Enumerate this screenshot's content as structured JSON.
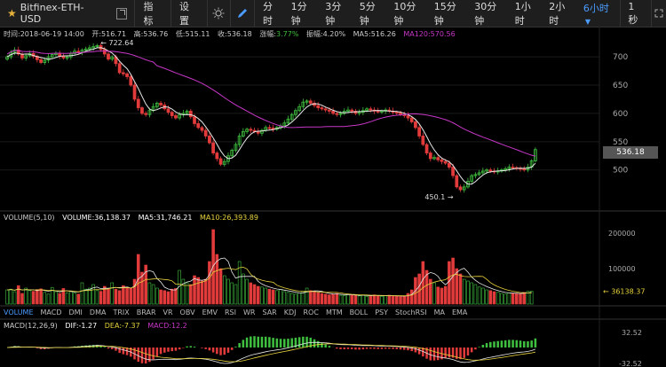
{
  "toolbar": {
    "symbol": "Bitfinex-ETH-USD",
    "indicator_btn": "指标",
    "settings_btn": "设置",
    "periods": [
      "分时",
      "1分钟",
      "3分钟",
      "5分钟",
      "10分钟",
      "15分钟",
      "30分钟",
      "1小时",
      "2小时",
      "6小时"
    ],
    "active_period": "6小时",
    "right_label": "1秒"
  },
  "info_bar": {
    "time": "时间:2018-06-19 14:00",
    "open": "开:516.71",
    "high": "高:536.76",
    "low": "低:515.11",
    "close": "收:536.18",
    "change_label": "涨幅:",
    "change_value": "3.77%",
    "amp_label": "振幅:",
    "amp_value": "4.20%",
    "ma5": "MA5:516.26",
    "ma120": "MA120:570.56"
  },
  "price_axis": [
    "700",
    "650",
    "600",
    "550",
    "500"
  ],
  "current_price": "536.18",
  "annotations": {
    "high": "← 722.64",
    "low": "450.1 →"
  },
  "volume": {
    "label": "VOLUME(5,10)",
    "value": "VOLUME:36,138.37",
    "ma5": "MA5:31,746.21",
    "ma10": "MA10:26,393.89",
    "axis": [
      "200000",
      "100000"
    ],
    "current": "← 36138.37"
  },
  "indicator_tabs": [
    "VOLUME",
    "MACD",
    "DMI",
    "DMA",
    "TRIX",
    "BRAR",
    "VR",
    "OBV",
    "EMV",
    "RSI",
    "WR",
    "SAR",
    "KDJ",
    "ROC",
    "MTM",
    "BOLL",
    "PSY",
    "StochRSI",
    "MA",
    "EMA"
  ],
  "macd": {
    "label": "MACD(12,26,9)",
    "dif": "DIF:-1.27",
    "dea": "DEA:-7.37",
    "macd": "MACD:12.2",
    "axis_top": "32.52",
    "axis_bottom": "-32.52"
  },
  "colors": {
    "up": "#3fbf3f",
    "down": "#e23b3b",
    "ma120": "#c837c8",
    "ma_white": "#e8e8e8",
    "ma_yellow": "#e6d23c",
    "accent": "#4b9cff"
  },
  "chart_data": {
    "type": "candlestick",
    "price_range": [
      440,
      730
    ],
    "closes": [
      700,
      708,
      712,
      705,
      698,
      702,
      706,
      701,
      695,
      690,
      694,
      700,
      704,
      706,
      701,
      698,
      700,
      706,
      710,
      708,
      712,
      714,
      716,
      718,
      720,
      713,
      705,
      696,
      700,
      688,
      672,
      670,
      665,
      650,
      625,
      610,
      600,
      598,
      605,
      612,
      618,
      615,
      608,
      602,
      596,
      592,
      598,
      600,
      604,
      594,
      582,
      575,
      570,
      560,
      548,
      530,
      520,
      510,
      515,
      525,
      535,
      545,
      560,
      568,
      572,
      570,
      568,
      565,
      570,
      575,
      574,
      572,
      575,
      578,
      583,
      590,
      598,
      605,
      612,
      620,
      622,
      618,
      614,
      610,
      608,
      606,
      604,
      600,
      598,
      600,
      604,
      606,
      604,
      600,
      602,
      605,
      608,
      606,
      604,
      603,
      604,
      606,
      604,
      602,
      601,
      598,
      596,
      592,
      585,
      575,
      560,
      545,
      530,
      520,
      522,
      518,
      515,
      512,
      505,
      490,
      470,
      465,
      470,
      480,
      490,
      492,
      495,
      498,
      500,
      498,
      497,
      498,
      500,
      502,
      505,
      504,
      503,
      502,
      500,
      505,
      516,
      536
    ],
    "volumes": [
      40000,
      42000,
      35000,
      52000,
      30000,
      45000,
      38000,
      36000,
      41000,
      43000,
      33000,
      28000,
      47000,
      35000,
      30000,
      44000,
      32000,
      36000,
      31000,
      28000,
      60000,
      42000,
      45000,
      55000,
      38000,
      36000,
      50000,
      44000,
      60000,
      42000,
      38000,
      52000,
      48000,
      45000,
      70000,
      140000,
      90000,
      110000,
      60000,
      55000,
      45000,
      40000,
      38000,
      35000,
      42000,
      44000,
      95000,
      70000,
      60000,
      55000,
      80000,
      75000,
      65000,
      70000,
      120000,
      210000,
      140000,
      100000,
      80000,
      70000,
      60000,
      55000,
      120000,
      85000,
      70000,
      60000,
      55000,
      50000,
      48000,
      45000,
      42000,
      40000,
      38000,
      41000,
      35000,
      33000,
      30000,
      28000,
      32000,
      36000,
      45000,
      38000,
      34000,
      32000,
      30000,
      28000,
      26000,
      28000,
      30000,
      25000,
      24000,
      27000,
      26000,
      24000,
      23000,
      25000,
      22000,
      24000,
      26000,
      23000,
      22000,
      24000,
      25000,
      23000,
      22000,
      21000,
      22000,
      30000,
      40000,
      75000,
      85000,
      120000,
      95000,
      70000,
      60000,
      48000,
      45000,
      50000,
      120000,
      130000,
      100000,
      85000,
      70000,
      65000,
      60000,
      55000,
      48000,
      45000,
      40000,
      38000,
      35000,
      33000,
      30000,
      28000,
      32000,
      31000,
      30000,
      28000,
      33000,
      36000,
      36138
    ]
  }
}
